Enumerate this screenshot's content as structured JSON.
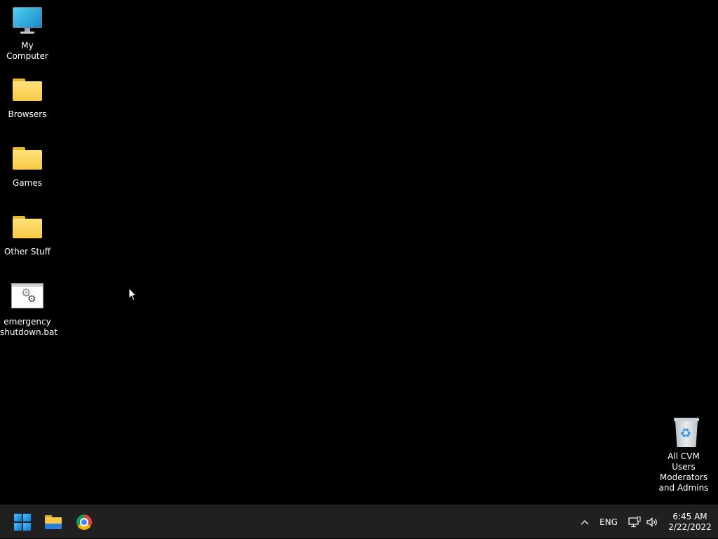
{
  "desktop": {
    "icons": [
      {
        "label": "My Computer",
        "icon": "monitor-icon"
      },
      {
        "label": "Browsers",
        "icon": "folder-icon"
      },
      {
        "label": "Games",
        "icon": "folder-icon"
      },
      {
        "label": "Other Stuff",
        "icon": "folder-icon"
      },
      {
        "label": "emergency\nshutdown.bat",
        "icon": "batch-file-icon"
      },
      {
        "label": "All CVM Users\nModerators\nand Admins",
        "icon": "recycle-bin-icon"
      }
    ],
    "background_color": "#000000"
  },
  "taskbar": {
    "background_color": "#202020",
    "pinned": [
      {
        "name": "Start",
        "icon": "windows-logo-icon"
      },
      {
        "name": "File Explorer",
        "icon": "file-explorer-icon"
      },
      {
        "name": "Google Chrome",
        "icon": "chrome-icon"
      }
    ],
    "tray": {
      "chevron": "^",
      "language": "ENG",
      "network_icon": "network-icon",
      "volume_icon": "volume-icon",
      "time": "6:45 AM",
      "date": "2/22/2022"
    }
  },
  "accent_color": "#0078d4"
}
